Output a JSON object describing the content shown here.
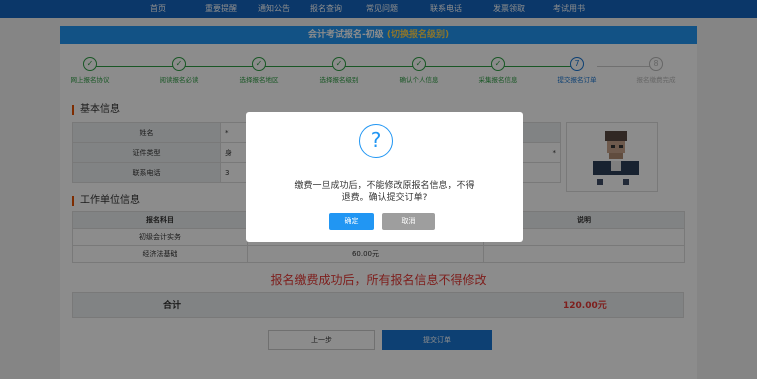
{
  "nav": {
    "items": [
      "首页",
      "重要提醒",
      "通知公告",
      "报名查询",
      "常见问题",
      "联系电话",
      "发票领取",
      "考试用书"
    ]
  },
  "page": {
    "title": "会计考试报名-初级",
    "switch_link": "(切换报名级别)"
  },
  "steps": [
    {
      "label": "网上报名协议",
      "icon": "✓",
      "status": "done"
    },
    {
      "label": "阅读报名必读",
      "icon": "✓",
      "status": "done"
    },
    {
      "label": "选择报名地区",
      "icon": "✓",
      "status": "done"
    },
    {
      "label": "选择报名级别",
      "icon": "✓",
      "status": "done"
    },
    {
      "label": "确认个人信息",
      "icon": "✓",
      "status": "done"
    },
    {
      "label": "采集报名信息",
      "icon": "✓",
      "status": "done"
    },
    {
      "label": "提交报名订单",
      "icon": "7",
      "status": "current"
    },
    {
      "label": "报名缴费完成",
      "icon": "8",
      "status": "pending"
    }
  ],
  "basic_info": {
    "heading": "基本信息",
    "rows": [
      {
        "label": "姓名",
        "value": "*"
      },
      {
        "label": "证件类型",
        "value": "身"
      },
      {
        "label": "联系电话",
        "value": "3"
      }
    ],
    "right_value": "*"
  },
  "work_info": {
    "heading": "工作单位信息",
    "headers": [
      "报名科目",
      "",
      "说明"
    ],
    "rows": [
      {
        "subject": "初级会计实务",
        "fee": ""
      },
      {
        "subject": "经济法基础",
        "fee": "60.00元"
      }
    ]
  },
  "notice": "报名缴费成功后，所有报名信息不得修改",
  "total": {
    "label": "合计",
    "amount": "120.00元"
  },
  "buttons": {
    "prev": "上一步",
    "submit": "提交订单"
  },
  "modal": {
    "icon": "?",
    "line1": "缴费一旦成功后，不能修改原报名信息，不得",
    "line2": "退费。确认提交订单?",
    "ok": "确定",
    "cancel": "取消"
  },
  "colors": {
    "nav": "#1565c0",
    "accent": "#2196f3",
    "done": "#2e9e44",
    "warning": "#e53935"
  }
}
